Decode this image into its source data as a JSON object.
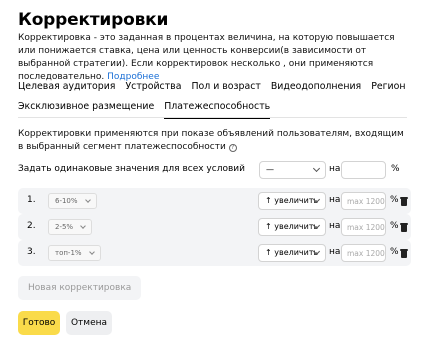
{
  "title": "Корректировки",
  "description": {
    "text": "Корректировка - это заданная в процентах величина, на которую повышается или понижается ставка, цена или ценность конверсии(в зависимости от выбранной стратегии). Если корректировок несколько , они применяются последовательно.",
    "link": "Подробнее"
  },
  "tabs_row1": [
    "Целевая аудитория",
    "Устройства",
    "Пол и возраст",
    "Видеодополнения",
    "Регион"
  ],
  "tabs_row2": [
    "Эксклюзивное размещение",
    "Платежеспособность"
  ],
  "active_tab": "Платежеспособность",
  "note": "Корректировки применяются при показе объявлений пользователям, входящим в выбранный сегмент платежеспособности",
  "all_conditions": {
    "label": "Задать одинаковые значения для всех условий",
    "select_value": "—",
    "on_label": "на",
    "input_value": "",
    "percent": "%"
  },
  "rows": [
    {
      "num": "1.",
      "segment": "6-10%",
      "direction": "↑ увеличить",
      "on_label": "на",
      "placeholder": "max 1200",
      "percent": "%"
    },
    {
      "num": "2.",
      "segment": "2-5%",
      "direction": "↑ увеличить",
      "on_label": "на",
      "placeholder": "max 1200",
      "percent": "%"
    },
    {
      "num": "3.",
      "segment": "топ-1%",
      "direction": "↑ увеличить",
      "on_label": "на",
      "placeholder": "max 1200",
      "percent": "%"
    }
  ],
  "buttons": {
    "new_adjustment": "Новая корректировка",
    "done": "Готово",
    "cancel": "Отмена"
  },
  "colors": {
    "link": "#1a6fd6",
    "primary_button": "#fadb4a",
    "row_background": "#f3f4f6"
  }
}
